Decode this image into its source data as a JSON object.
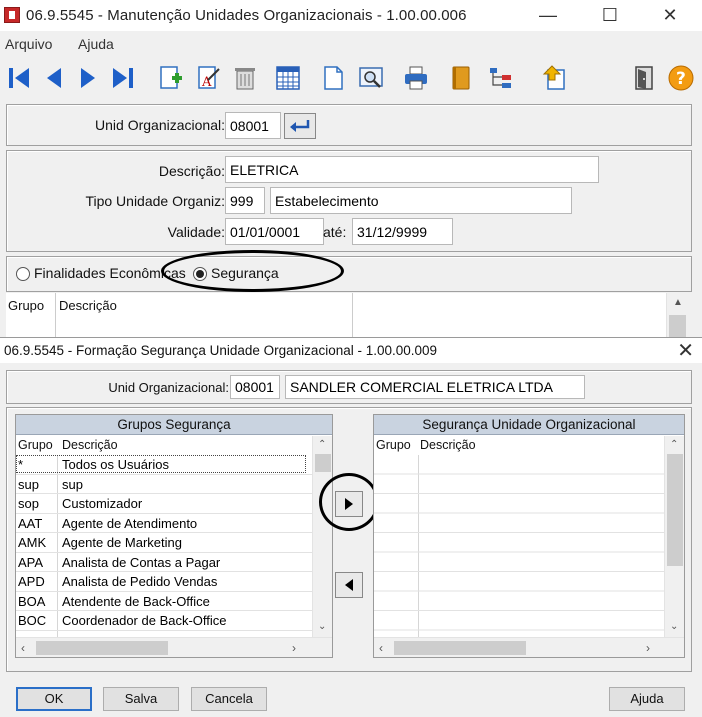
{
  "main_window": {
    "title": "06.9.5545 - Manutenção Unidades Organizacionais - 1.00.00.006",
    "menu": [
      "Arquivo",
      "Ajuda"
    ],
    "fields": {
      "unid_label": "Unid Organizacional:",
      "unid_value": "08001",
      "descricao_label": "Descrição:",
      "descricao_value": "ELETRICA",
      "tipo_label": "Tipo Unidade Organiz:",
      "tipo_code": "999",
      "tipo_desc": "Estabelecimento",
      "validade_label": "Validade:",
      "validade_from": "01/01/0001",
      "ate_label": "até:",
      "validade_to": "31/12/9999"
    },
    "radios": {
      "finalidades": "Finalidades Econômicas",
      "seguranca": "Segurança",
      "selected": "seguranca"
    },
    "grid": {
      "col_grupo": "Grupo",
      "col_descricao": "Descrição"
    }
  },
  "dialog": {
    "title": "06.9.5545 - Formação Segurança Unidade Organizacional - 1.00.00.009",
    "unid_label": "Unid Organizacional:",
    "unid_value": "08001",
    "unid_name": "SANDLER COMERCIAL ELETRICA LTDA",
    "left_grid": {
      "title": "Grupos Segurança",
      "col_grupo": "Grupo",
      "col_descricao": "Descrição",
      "rows": [
        {
          "grupo": "*",
          "descricao": "Todos os Usuários"
        },
        {
          "grupo": "sup",
          "descricao": "sup"
        },
        {
          "grupo": "sop",
          "descricao": "Customizador"
        },
        {
          "grupo": "AAT",
          "descricao": "Agente de Atendimento"
        },
        {
          "grupo": "AMK",
          "descricao": "Agente de Marketing"
        },
        {
          "grupo": "APA",
          "descricao": "Analista de Contas a Pagar"
        },
        {
          "grupo": "APD",
          "descricao": "Analista de Pedido Vendas"
        },
        {
          "grupo": "BOA",
          "descricao": "Atendente de Back-Office"
        },
        {
          "grupo": "BOC",
          "descricao": "Coordenador de Back-Office"
        }
      ]
    },
    "right_grid": {
      "title": "Segurança Unidade Organizacional",
      "col_grupo": "Grupo",
      "col_descricao": "Descrição"
    },
    "buttons": {
      "ok": "OK",
      "salva": "Salva",
      "cancela": "Cancela",
      "ajuda": "Ajuda"
    }
  }
}
